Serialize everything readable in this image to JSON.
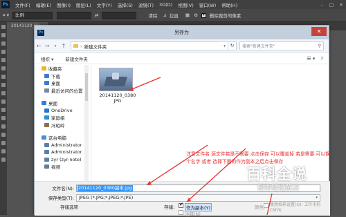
{
  "ps": {
    "logo": "Ps",
    "menu": [
      "文件(F)",
      "编辑(E)",
      "图像(I)",
      "图层(L)",
      "文字(Y)",
      "选择(S)",
      "滤镜(T)",
      "3D(D)",
      "视图(V)",
      "窗口(W)",
      "帮助(H)"
    ],
    "options": {
      "ratio": "比例",
      "swap": "⇄",
      "clear": "清除",
      "straighten": "拉直",
      "delete_crop": "删除裁剪的像素"
    },
    "doc_tab": "20141120_03..."
  },
  "dialog": {
    "title": "另存为",
    "address": "新建文件夹",
    "search_placeholder": "搜索\"新建文件夹\"",
    "organize": "组织 ▾",
    "new_folder": "新建文件夹",
    "nav_items": [
      {
        "label": "收藏夹",
        "icon": "star-icon",
        "color": "#e8b830"
      },
      {
        "label": "下载",
        "icon": "download-icon",
        "color": "#3a7bd5"
      },
      {
        "label": "桌面",
        "icon": "desktop-icon",
        "color": "#3a7bd5"
      },
      {
        "label": "最近访问的位置",
        "icon": "recent-icon",
        "color": "#7a8a9a"
      },
      {
        "label": "",
        "icon": "",
        "color": ""
      },
      {
        "label": "桌面",
        "icon": "desktop-icon",
        "color": "#3a7bd5"
      },
      {
        "label": "OneDrive",
        "icon": "cloud-icon",
        "color": "#1f78d1"
      },
      {
        "label": "家庭组",
        "icon": "homegroup-icon",
        "color": "#2f8fd5"
      },
      {
        "label": "冯昭岭",
        "icon": "user-icon",
        "color": "#8a6d4f"
      },
      {
        "label": "",
        "icon": "",
        "color": ""
      },
      {
        "label": "这台电脑",
        "icon": "computer-icon",
        "color": "#4a8ad8"
      },
      {
        "label": "Administrator",
        "icon": "user-icon",
        "color": "#5b7fa8"
      },
      {
        "label": "Administrator",
        "icon": "user-icon",
        "color": "#5b7fa8"
      },
      {
        "label": "zyr (zyr-note)",
        "icon": "user-icon",
        "color": "#5b7fa8"
      },
      {
        "label": "视频",
        "icon": "video-icon",
        "color": "#6b7b8b"
      }
    ],
    "file": {
      "name": "20141120_0380",
      "ext": "JPG"
    },
    "annotation": "注意文件名 源文件若是不需要 点击保存 可以覆盖掉 若是需要 可以换个名字 或者 选择下面的作为副本之后点击保存",
    "filename_label": "文件名(N):",
    "filename_value": "20141120_0380副本.jpg",
    "filetype_label": "保存类型(T):",
    "filetype_value": "JPEG (*.JPG;*.JPEG;*.JPE)",
    "save_options_title": "存储选项",
    "save_label": "存储:",
    "as_copy": "作为副本(Y)",
    "notes": "注释(N)",
    "color_label": "颜色:",
    "color_profile": "使用校样设置(O): 工作中的 CMYK",
    "colors": {
      "accent": "#3399ff",
      "annotation": "#e83030",
      "close": "#c7433a"
    }
  },
  "watermark": {
    "title": "百科全说",
    "subtitle": "助你轻松解决"
  }
}
